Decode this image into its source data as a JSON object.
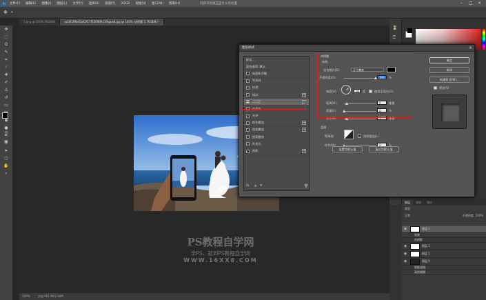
{
  "menubar": {
    "logo": "Ps",
    "items": [
      "文件(F)",
      "编辑(E)",
      "图像(I)",
      "图层(L)",
      "文字(Y)",
      "选择(S)",
      "滤镜(T)",
      "3D(D)",
      "视图(V)",
      "窗口(W)",
      "帮助(H)"
    ],
    "window_title": "内容识别填充是什么的位置"
  },
  "tabs": [
    {
      "label": "1.png @ 100% (RGB/8)"
    },
    {
      "label": "aa361f8d45b42f17f556f8fe13f6gox8.jpg @ 100% (内阴影 1, RGB/8) *"
    }
  ],
  "status": {
    "zoom": "100%",
    "doc": "文档:961.9K/2.40M"
  },
  "dialog": {
    "title": "图层样式",
    "styles_header": "样式",
    "blend_options": "混合选项: 默认",
    "style_items": [
      {
        "label": "斜面和浮雕",
        "checked": false,
        "plus": false
      },
      {
        "label": "等高线",
        "checked": false,
        "plus": false
      },
      {
        "label": "纹理",
        "checked": false,
        "plus": false
      },
      {
        "label": "描边",
        "checked": false,
        "plus": true
      },
      {
        "label": "内阴影",
        "checked": true,
        "plus": true
      },
      {
        "label": "内发光",
        "checked": false,
        "plus": false
      },
      {
        "label": "光泽",
        "checked": false,
        "plus": false
      },
      {
        "label": "颜色叠加",
        "checked": false,
        "plus": true
      },
      {
        "label": "渐变叠加",
        "checked": false,
        "plus": true
      },
      {
        "label": "图案叠加",
        "checked": false,
        "plus": false
      },
      {
        "label": "外发光",
        "checked": false,
        "plus": false
      },
      {
        "label": "投影",
        "checked": false,
        "plus": true
      }
    ],
    "fx_label": "fx",
    "section_title": "内阴影",
    "section_sub": "结构",
    "blend_mode_label": "混合模式(B):",
    "blend_mode_value": "正片叠底",
    "opacity_label": "不透明度(O):",
    "opacity_value": "100",
    "angle_label": "角度(A):",
    "angle_value": "30",
    "global_light": "使用全局光(G)",
    "distance_label": "距离(D):",
    "distance_value": "5",
    "choke_label": "阻塞(C):",
    "choke_value": "0",
    "size_label": "大小(S):",
    "size_value": "5",
    "unit_px": "像素",
    "unit_pct": "%",
    "unit_deg": "度",
    "quality_title": "品质",
    "contour_label": "等高线:",
    "antialias": "消除锯齿(L)",
    "noise_label": "杂色(N):",
    "noise_value": "0",
    "make_default": "设置为默认值",
    "reset_default": "复位为默认值",
    "ok": "确定",
    "cancel": "取消",
    "new_style": "新建样式(W)...",
    "preview": "预览(V)"
  },
  "layers": {
    "tabs": [
      "图层",
      "通道",
      "路径"
    ],
    "kind": "类型",
    "mode": "正常",
    "opacity_label": "不透明度:",
    "opacity_value": "100%",
    "rows": [
      {
        "name": "图层 1",
        "type": "layer",
        "dark": false,
        "sel": true
      },
      {
        "name": "效果",
        "type": "sub"
      },
      {
        "name": "内阴影",
        "type": "sub"
      },
      {
        "name": "图层 1",
        "type": "layer",
        "dark": false,
        "sel": false
      },
      {
        "name": "图层 1",
        "type": "layer",
        "dark": false,
        "sel": false
      },
      {
        "name": "图层 0",
        "type": "layer",
        "dark": true,
        "sel": false
      },
      {
        "name": "智能滤镜",
        "type": "sub"
      },
      {
        "name": "高斯模糊",
        "type": "sub"
      }
    ]
  },
  "watermark": {
    "line1": "PS教程自学网",
    "line2": "学PS，就到PS教程自学网",
    "line3": "WWW.16XX8.COM"
  },
  "colors": {
    "accent_red": "#e02020",
    "panel_bg": "#535353"
  }
}
